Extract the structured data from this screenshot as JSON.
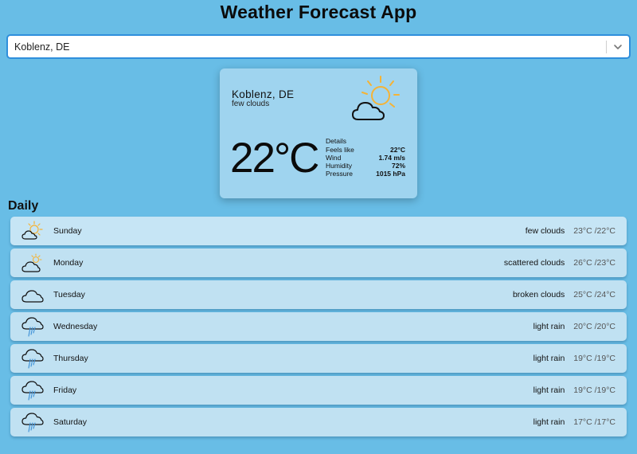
{
  "app": {
    "title": "Weather Forecast App"
  },
  "search": {
    "value": "Koblenz, DE"
  },
  "current": {
    "city": "Koblenz, DE",
    "description": "few clouds",
    "temperature": "22°C",
    "icon": "few-clouds-icon",
    "details_label": "Details",
    "details": [
      {
        "label": "Feels like",
        "value": "22°C"
      },
      {
        "label": "Wind",
        "value": "1.74 m/s"
      },
      {
        "label": "Humidity",
        "value": "72%"
      },
      {
        "label": "Pressure",
        "value": "1015 hPa"
      }
    ]
  },
  "daily": {
    "title": "Daily",
    "days": [
      {
        "day": "Sunday",
        "description": "few clouds",
        "temps": "23°C /22°C",
        "icon": "few-clouds-icon"
      },
      {
        "day": "Monday",
        "description": "scattered clouds",
        "temps": "26°C /23°C",
        "icon": "scattered-clouds-icon"
      },
      {
        "day": "Tuesday",
        "description": "broken clouds",
        "temps": "25°C /24°C",
        "icon": "cloud-icon"
      },
      {
        "day": "Wednesday",
        "description": "light rain",
        "temps": "20°C /20°C",
        "icon": "rain-icon"
      },
      {
        "day": "Thursday",
        "description": "light rain",
        "temps": "19°C /19°C",
        "icon": "rain-icon"
      },
      {
        "day": "Friday",
        "description": "light rain",
        "temps": "19°C /19°C",
        "icon": "rain-icon"
      },
      {
        "day": "Saturday",
        "description": "light rain",
        "temps": "17°C /17°C",
        "icon": "rain-icon"
      }
    ]
  },
  "colors": {
    "background": "#68bde6",
    "card": "#9fd4ef",
    "row": "#c0e1f2",
    "sun": "#f5b335",
    "rain": "#3a8fd6"
  }
}
